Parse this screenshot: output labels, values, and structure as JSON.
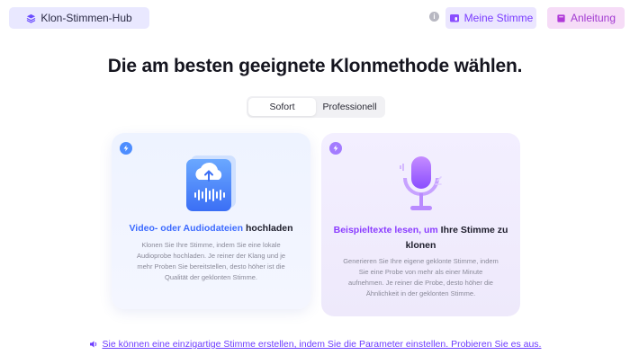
{
  "header": {
    "hub_label": "Klon-Stimmen-Hub",
    "info_icon": "info-icon",
    "my_voice_label": "Meine Stimme",
    "guide_label": "Anleitung"
  },
  "main": {
    "title": "Die am besten geeignete Klonmethode wählen.",
    "tabs": [
      {
        "label": "Sofort",
        "active": true
      },
      {
        "label": "Professionell",
        "active": false
      }
    ],
    "cards": [
      {
        "icon": "lightning-icon",
        "illustration": "cloud-upload-audio-icon",
        "heading_highlight": "Video- oder Audiodateien",
        "heading_rest": " hochladen",
        "description": "Klonen Sie Ihre Stimme, indem Sie eine lokale Audioprobe hochladen. Je reiner der Klang und je mehr Proben Sie bereitstellen, desto höher ist die Qualität der geklonten Stimme."
      },
      {
        "icon": "lightning-icon",
        "illustration": "microphone-icon",
        "heading_highlight": "Beispieltexte lesen, um",
        "heading_rest": "  Ihre Stimme zu klonen",
        "description": "Generieren Sie Ihre eigene geklonte Stimme, indem Sie eine Probe von mehr als einer Minute aufnehmen. Je reiner die Probe, desto höher die Ähnlichkeit in der geklonten Stimme."
      }
    ]
  },
  "footer": {
    "icon": "speaker-icon",
    "link_text": "Sie können eine einzigartige Stimme erstellen, indem Sie die Parameter einstellen. Probieren Sie es aus."
  },
  "colors": {
    "accent_purple": "#7a3cff",
    "accent_blue": "#3d6bff",
    "guide_pink": "#a23ad1"
  }
}
